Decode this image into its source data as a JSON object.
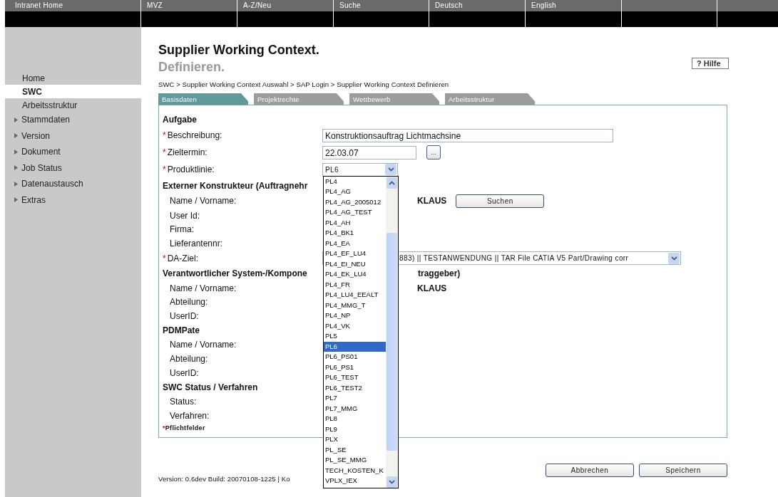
{
  "top_nav": [
    {
      "label": "Intranet Home"
    },
    {
      "label": "MVZ"
    },
    {
      "label": "A-Z/Neu"
    },
    {
      "label": "Suche"
    },
    {
      "label": "Deutsch"
    },
    {
      "label": "English"
    }
  ],
  "sidebar": {
    "items": [
      {
        "label": "Home",
        "selected": false,
        "kind": "link"
      },
      {
        "label": "SWC",
        "selected": true,
        "kind": "link"
      },
      {
        "label": "Arbeitsstruktur",
        "selected": false,
        "kind": "link"
      },
      {
        "label": "Stammdaten",
        "selected": false,
        "kind": "expandable"
      },
      {
        "label": "Version",
        "selected": false,
        "kind": "expandable"
      },
      {
        "label": "Dokument",
        "selected": false,
        "kind": "expandable"
      },
      {
        "label": "Job Status",
        "selected": false,
        "kind": "expandable"
      },
      {
        "label": "Datenaustausch",
        "selected": false,
        "kind": "expandable"
      },
      {
        "label": "Extras",
        "selected": false,
        "kind": "expandable"
      }
    ]
  },
  "page": {
    "title": "Supplier Working Context.",
    "subtitle": "Definieren.",
    "help_button": "? Hilfe"
  },
  "breadcrumb": "SWC > Supplier Working Context Auswahl > SAP Login > Supplier Working Context Definieren",
  "tabs": [
    {
      "label": "Basisdaten",
      "selected": true
    },
    {
      "label": "Projektrechte",
      "selected": false
    },
    {
      "label": "Wettbewerb",
      "selected": false
    },
    {
      "label": "Arbeitsstruktur",
      "selected": false
    }
  ],
  "form": {
    "required_mark": "*",
    "sections": [
      {
        "title": "Aufgabe",
        "rows": [
          {
            "kind": "text_input",
            "label": "Beschreibung:",
            "required": true,
            "value": "Konstruktionsauftrag Lichtmachsine"
          },
          {
            "kind": "date_input",
            "label": "Zieltermin:",
            "required": true,
            "value": "22.03.07",
            "button": "..."
          },
          {
            "kind": "select",
            "label": "Produktlinie:",
            "required": true,
            "value": "PL6"
          }
        ]
      },
      {
        "title": "Externer Konstrukteur (Auftragnehr",
        "rows": [
          {
            "kind": "value_button",
            "label": "Name / Vorname:",
            "required": false,
            "value": "KLAUS",
            "button": "Suchen"
          },
          {
            "kind": "plain",
            "label": "User Id:",
            "required": false
          },
          {
            "kind": "plain",
            "label": "Firma:",
            "required": false
          },
          {
            "kind": "plain",
            "label": "Lieferantennr:",
            "required": false
          },
          {
            "kind": "wide_select",
            "label": "DA-Ziel:",
            "required": true,
            "value": "883) || TESTANWENDUNG || TAR File CATIA V5 Part/Drawing corr"
          }
        ]
      },
      {
        "title": "Verantwortlicher System-/Kompone",
        "title_tail": "traggeber)",
        "rows": [
          {
            "kind": "value",
            "label": "Name / Vorname:",
            "required": false,
            "value": "KLAUS"
          },
          {
            "kind": "plain",
            "label": "Abteilung:",
            "required": false
          },
          {
            "kind": "plain",
            "label": "UserID:",
            "required": false
          }
        ]
      },
      {
        "title": "PDMPate",
        "rows": [
          {
            "kind": "plain",
            "label": "Name / Vorname:",
            "required": false
          },
          {
            "kind": "plain",
            "label": "Abteilung:",
            "required": false
          },
          {
            "kind": "plain",
            "label": "UserID:",
            "required": false
          }
        ]
      },
      {
        "title": "SWC Status / Verfahren",
        "rows": [
          {
            "kind": "plain",
            "label": "Status:",
            "required": false
          },
          {
            "kind": "plain",
            "label": "Verfahren:",
            "required": false
          }
        ]
      }
    ],
    "required_note": "Pflichtfelder"
  },
  "dropdown_list": {
    "items": [
      {
        "label": "PL4",
        "selected": false
      },
      {
        "label": "PL4_AG",
        "selected": false
      },
      {
        "label": "PL4_AG_2005012",
        "selected": false
      },
      {
        "label": "PL4_AG_TEST",
        "selected": false
      },
      {
        "label": "PL4_AH",
        "selected": false
      },
      {
        "label": "PL4_BK1",
        "selected": false
      },
      {
        "label": "PL4_EA",
        "selected": false
      },
      {
        "label": "PL4_EF_LU4",
        "selected": false
      },
      {
        "label": "PL4_EI_NEU",
        "selected": false
      },
      {
        "label": "PL4_EK_LU4",
        "selected": false
      },
      {
        "label": "PL4_FR",
        "selected": false
      },
      {
        "label": "PL4_LU4_EEALT",
        "selected": false
      },
      {
        "label": "PL4_MMG_T",
        "selected": false
      },
      {
        "label": "PL4_NP",
        "selected": false
      },
      {
        "label": "PL4_VK",
        "selected": false
      },
      {
        "label": "PL5",
        "selected": false
      },
      {
        "label": "PL6",
        "selected": true
      },
      {
        "label": "PL6_PS01",
        "selected": false
      },
      {
        "label": "PL6_PS1",
        "selected": false
      },
      {
        "label": "PL6_TEST",
        "selected": false
      },
      {
        "label": "PL6_TEST2",
        "selected": false
      },
      {
        "label": "PL7",
        "selected": false
      },
      {
        "label": "PL7_MMG",
        "selected": false
      },
      {
        "label": "PL8",
        "selected": false
      },
      {
        "label": "PL9",
        "selected": false
      },
      {
        "label": "PLX",
        "selected": false
      },
      {
        "label": "PL_SE",
        "selected": false
      },
      {
        "label": "PL_SE_MMG",
        "selected": false
      },
      {
        "label": "TECH_KOSTEN_K",
        "selected": false
      },
      {
        "label": "VPLX_IEX",
        "selected": false
      }
    ]
  },
  "buttons": [
    {
      "label": "Abbrechen"
    },
    {
      "label": "Speichern"
    }
  ],
  "footer": "Version: 0.6dev Build: 20070108-1225 | Ko"
}
